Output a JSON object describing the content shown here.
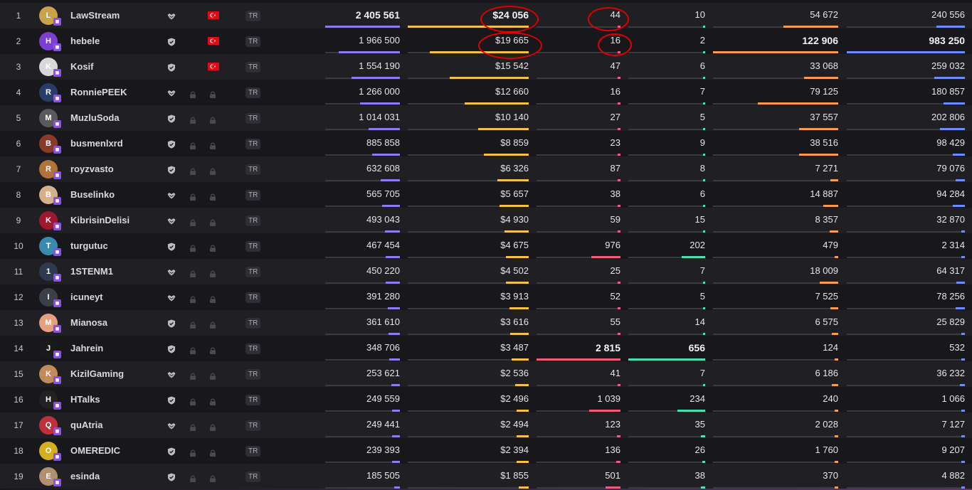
{
  "colors": {
    "viewers_bar": "#8b7cf6",
    "earnings_bar": "#f5c04a",
    "col3_bar": "#f05d7a",
    "col4_bar": "#4be0b0",
    "col5_bar": "#ff9a4a",
    "col6_bar": "#6f8cff",
    "annotation": "#e00000",
    "twitch": "#9146ff",
    "flag_tr": "#e30a17"
  },
  "icons": {
    "verified": "shield-check-icon",
    "partner": "handshake-icon",
    "lock": "lock-icon",
    "platform": "twitch-icon",
    "flag": "turkey-flag-icon"
  },
  "rows": [
    {
      "rank": "1",
      "name": "LawStream",
      "avatar": "#c9a24a",
      "badge": "partner",
      "locks": 0,
      "flag": true,
      "lang": "TR",
      "viewers": "2 405 561",
      "viewers_frac": 1.0,
      "earnings": "$24 056",
      "earnings_frac": 1.0,
      "c3": "44",
      "c3_frac": 0.016,
      "c4": "10",
      "c4_frac": 0.015,
      "c5": "54 672",
      "c5_frac": 0.44,
      "c6": "240 556",
      "c6_frac": 0.24,
      "bold": [
        "viewers",
        "earnings"
      ]
    },
    {
      "rank": "2",
      "name": "hebele",
      "avatar": "#7b3fd1",
      "badge": "verified",
      "locks": 0,
      "flag": true,
      "lang": "TR",
      "viewers": "1 966 500",
      "viewers_frac": 0.82,
      "earnings": "$19 665",
      "earnings_frac": 0.82,
      "c3": "16",
      "c3_frac": 0.006,
      "c4": "2",
      "c4_frac": 0.003,
      "c5": "122 906",
      "c5_frac": 1.0,
      "c6": "983 250",
      "c6_frac": 1.0,
      "bold": [
        "c5",
        "c6"
      ]
    },
    {
      "rank": "3",
      "name": "Kosif",
      "avatar": "#d8d8d8",
      "badge": "verified",
      "locks": 0,
      "flag": true,
      "lang": "TR",
      "viewers": "1 554 190",
      "viewers_frac": 0.65,
      "earnings": "$15 542",
      "earnings_frac": 0.65,
      "c3": "47",
      "c3_frac": 0.017,
      "c4": "6",
      "c4_frac": 0.009,
      "c5": "33 068",
      "c5_frac": 0.27,
      "c6": "259 032",
      "c6_frac": 0.26,
      "bold": []
    },
    {
      "rank": "4",
      "name": "RonniePEEK",
      "avatar": "#2a3d6a",
      "badge": "partner",
      "locks": 2,
      "flag": false,
      "lang": "TR",
      "viewers": "1 266 000",
      "viewers_frac": 0.53,
      "earnings": "$12 660",
      "earnings_frac": 0.53,
      "c3": "16",
      "c3_frac": 0.006,
      "c4": "7",
      "c4_frac": 0.011,
      "c5": "79 125",
      "c5_frac": 0.64,
      "c6": "180 857",
      "c6_frac": 0.18,
      "bold": []
    },
    {
      "rank": "5",
      "name": "MuzluSoda",
      "avatar": "#5a5a5a",
      "badge": "verified",
      "locks": 2,
      "flag": false,
      "lang": "TR",
      "viewers": "1 014 031",
      "viewers_frac": 0.42,
      "earnings": "$10 140",
      "earnings_frac": 0.42,
      "c3": "27",
      "c3_frac": 0.01,
      "c4": "5",
      "c4_frac": 0.008,
      "c5": "37 557",
      "c5_frac": 0.31,
      "c6": "202 806",
      "c6_frac": 0.21,
      "bold": []
    },
    {
      "rank": "6",
      "name": "busmenlxrd",
      "avatar": "#8a3a2a",
      "badge": "verified",
      "locks": 2,
      "flag": false,
      "lang": "TR",
      "viewers": "885 858",
      "viewers_frac": 0.37,
      "earnings": "$8 859",
      "earnings_frac": 0.37,
      "c3": "23",
      "c3_frac": 0.008,
      "c4": "9",
      "c4_frac": 0.014,
      "c5": "38 516",
      "c5_frac": 0.31,
      "c6": "98 429",
      "c6_frac": 0.1,
      "bold": []
    },
    {
      "rank": "7",
      "name": "royzvasto",
      "avatar": "#b0733a",
      "badge": "verified",
      "locks": 2,
      "flag": false,
      "lang": "TR",
      "viewers": "632 608",
      "viewers_frac": 0.26,
      "earnings": "$6 326",
      "earnings_frac": 0.26,
      "c3": "87",
      "c3_frac": 0.031,
      "c4": "8",
      "c4_frac": 0.012,
      "c5": "7 271",
      "c5_frac": 0.06,
      "c6": "79 076",
      "c6_frac": 0.08,
      "bold": []
    },
    {
      "rank": "8",
      "name": "Buselinko",
      "avatar": "#d6b08a",
      "badge": "partner",
      "locks": 2,
      "flag": false,
      "lang": "TR",
      "viewers": "565 705",
      "viewers_frac": 0.24,
      "earnings": "$5 657",
      "earnings_frac": 0.24,
      "c3": "38",
      "c3_frac": 0.013,
      "c4": "6",
      "c4_frac": 0.009,
      "c5": "14 887",
      "c5_frac": 0.12,
      "c6": "94 284",
      "c6_frac": 0.1,
      "bold": []
    },
    {
      "rank": "9",
      "name": "KibrisinDelisi",
      "avatar": "#a01830",
      "badge": "partner",
      "locks": 2,
      "flag": false,
      "lang": "TR",
      "viewers": "493 043",
      "viewers_frac": 0.2,
      "earnings": "$4 930",
      "earnings_frac": 0.2,
      "c3": "59",
      "c3_frac": 0.021,
      "c4": "15",
      "c4_frac": 0.023,
      "c5": "8 357",
      "c5_frac": 0.07,
      "c6": "32 870",
      "c6_frac": 0.03,
      "bold": []
    },
    {
      "rank": "10",
      "name": "turgutuc",
      "avatar": "#3a8ab0",
      "badge": "verified",
      "locks": 2,
      "flag": false,
      "lang": "TR",
      "viewers": "467 454",
      "viewers_frac": 0.19,
      "earnings": "$4 675",
      "earnings_frac": 0.19,
      "c3": "976",
      "c3_frac": 0.35,
      "c4": "202",
      "c4_frac": 0.31,
      "c5": "479",
      "c5_frac": 0.004,
      "c6": "2 314",
      "c6_frac": 0.002,
      "bold": []
    },
    {
      "rank": "11",
      "name": "1STENM1",
      "avatar": "#2f3a52",
      "badge": "partner",
      "locks": 2,
      "flag": false,
      "lang": "TR",
      "viewers": "450 220",
      "viewers_frac": 0.19,
      "earnings": "$4 502",
      "earnings_frac": 0.19,
      "c3": "25",
      "c3_frac": 0.009,
      "c4": "7",
      "c4_frac": 0.011,
      "c5": "18 009",
      "c5_frac": 0.15,
      "c6": "64 317",
      "c6_frac": 0.07,
      "bold": []
    },
    {
      "rank": "12",
      "name": "icuneyt",
      "avatar": "#3a4048",
      "badge": "partner",
      "locks": 2,
      "flag": false,
      "lang": "TR",
      "viewers": "391 280",
      "viewers_frac": 0.16,
      "earnings": "$3 913",
      "earnings_frac": 0.16,
      "c3": "52",
      "c3_frac": 0.018,
      "c4": "5",
      "c4_frac": 0.008,
      "c5": "7 525",
      "c5_frac": 0.06,
      "c6": "78 256",
      "c6_frac": 0.08,
      "bold": []
    },
    {
      "rank": "13",
      "name": "Mianosa",
      "avatar": "#e6a080",
      "badge": "verified",
      "locks": 2,
      "flag": false,
      "lang": "TR",
      "viewers": "361 610",
      "viewers_frac": 0.15,
      "earnings": "$3 616",
      "earnings_frac": 0.15,
      "c3": "55",
      "c3_frac": 0.02,
      "c4": "14",
      "c4_frac": 0.021,
      "c5": "6 575",
      "c5_frac": 0.05,
      "c6": "25 829",
      "c6_frac": 0.03,
      "bold": []
    },
    {
      "rank": "14",
      "name": "Jahrein",
      "avatar": "#1a1a1a",
      "badge": "verified",
      "locks": 2,
      "flag": false,
      "lang": "TR",
      "viewers": "348 706",
      "viewers_frac": 0.14,
      "earnings": "$3 487",
      "earnings_frac": 0.14,
      "c3": "2 815",
      "c3_frac": 1.0,
      "c4": "656",
      "c4_frac": 1.0,
      "c5": "124",
      "c5_frac": 0.001,
      "c6": "532",
      "c6_frac": 0.001,
      "bold": [
        "c3",
        "c4"
      ]
    },
    {
      "rank": "15",
      "name": "KizilGaming",
      "avatar": "#c08a5a",
      "badge": "partner",
      "locks": 2,
      "flag": false,
      "lang": "TR",
      "viewers": "253 621",
      "viewers_frac": 0.11,
      "earnings": "$2 536",
      "earnings_frac": 0.11,
      "c3": "41",
      "c3_frac": 0.015,
      "c4": "7",
      "c4_frac": 0.011,
      "c5": "6 186",
      "c5_frac": 0.05,
      "c6": "36 232",
      "c6_frac": 0.04,
      "bold": []
    },
    {
      "rank": "16",
      "name": "HTalks",
      "avatar": "#222222",
      "badge": "verified",
      "locks": 2,
      "flag": false,
      "lang": "TR",
      "viewers": "249 559",
      "viewers_frac": 0.1,
      "earnings": "$2 496",
      "earnings_frac": 0.1,
      "c3": "1 039",
      "c3_frac": 0.37,
      "c4": "234",
      "c4_frac": 0.36,
      "c5": "240",
      "c5_frac": 0.002,
      "c6": "1 066",
      "c6_frac": 0.001,
      "bold": []
    },
    {
      "rank": "17",
      "name": "quAtria",
      "avatar": "#c0303a",
      "badge": "partner",
      "locks": 2,
      "flag": false,
      "lang": "TR",
      "viewers": "249 441",
      "viewers_frac": 0.1,
      "earnings": "$2 494",
      "earnings_frac": 0.1,
      "c3": "123",
      "c3_frac": 0.044,
      "c4": "35",
      "c4_frac": 0.053,
      "c5": "2 028",
      "c5_frac": 0.016,
      "c6": "7 127",
      "c6_frac": 0.007,
      "bold": []
    },
    {
      "rank": "18",
      "name": "OMEREDIC",
      "avatar": "#d4b020",
      "badge": "verified",
      "locks": 2,
      "flag": false,
      "lang": "TR",
      "viewers": "239 393",
      "viewers_frac": 0.1,
      "earnings": "$2 394",
      "earnings_frac": 0.1,
      "c3": "136",
      "c3_frac": 0.048,
      "c4": "26",
      "c4_frac": 0.04,
      "c5": "1 760",
      "c5_frac": 0.014,
      "c6": "9 207",
      "c6_frac": 0.009,
      "bold": []
    },
    {
      "rank": "19",
      "name": "esinda",
      "avatar": "#b09070",
      "badge": "verified",
      "locks": 2,
      "flag": false,
      "lang": "TR",
      "viewers": "185 505",
      "viewers_frac": 0.08,
      "earnings": "$1 855",
      "earnings_frac": 0.08,
      "c3": "501",
      "c3_frac": 0.18,
      "c4": "38",
      "c4_frac": 0.058,
      "c5": "370",
      "c5_frac": 0.003,
      "c6": "4 882",
      "c6_frac": 0.005,
      "bold": []
    }
  ]
}
